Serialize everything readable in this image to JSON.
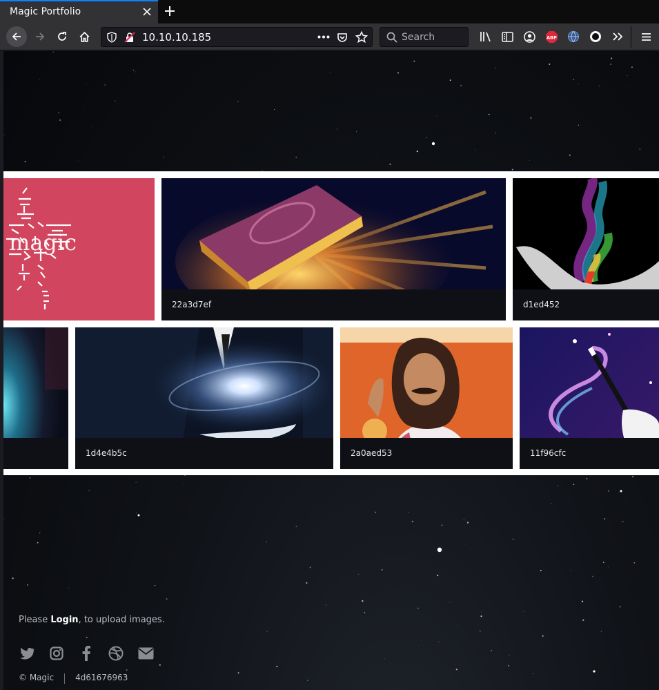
{
  "browser": {
    "tab_title": "Magic Portfolio",
    "url": "10.10.10.185",
    "search_placeholder": "Search",
    "icons": [
      "back-arrow-icon",
      "forward-arrow-icon",
      "reload-icon",
      "home-icon",
      "shield-icon",
      "insecure-lock-icon",
      "page-actions-icon",
      "pocket-icon",
      "bookmark-star-icon",
      "search-icon",
      "library-icon",
      "sidebar-icon",
      "account-icon",
      "adblock-icon",
      "extension-globe-icon",
      "extension-circle-icon",
      "overflow-chevron-icon",
      "menu-icon"
    ],
    "adblock_label": "ABP"
  },
  "gallery": {
    "tiles": [
      {
        "name": "magic-logo",
        "caption": ""
      },
      {
        "name": "glowing-book",
        "caption": "22a3d7ef"
      },
      {
        "name": "rainbow-smoke-hand",
        "caption": "d1ed452"
      },
      {
        "name": "glowing-orb",
        "caption": ""
      },
      {
        "name": "galaxy-in-hand",
        "caption": "1d4e4b5c"
      },
      {
        "name": "magician-man",
        "caption": "2a0aed53"
      },
      {
        "name": "magic-wand",
        "caption": "11f96cfc"
      }
    ],
    "logo_text": "magic"
  },
  "footer": {
    "text_before": "Please ",
    "login_label": "Login",
    "text_after": ", to upload images.",
    "social_icons": [
      "twitter-icon",
      "instagram-icon",
      "facebook-icon",
      "dribbble-icon",
      "envelope-icon"
    ],
    "copyright": "© Magic",
    "hash": "4d61676963"
  },
  "colors": {
    "accent_tab": "#0a84ff",
    "logo_tile": "#d2455f",
    "caption_bg": "#0e1016"
  }
}
